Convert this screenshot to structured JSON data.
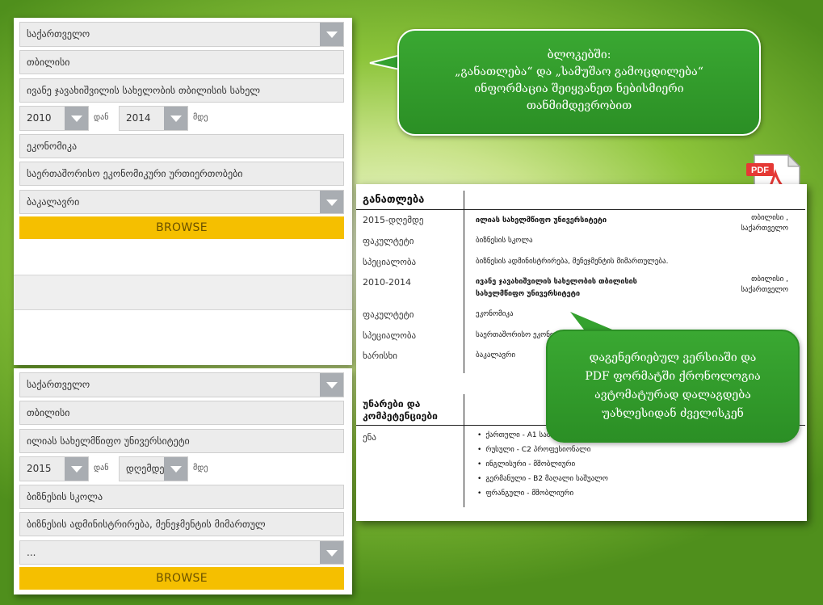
{
  "form_top": {
    "country": "საქართველო",
    "city": "თბილისი",
    "university": "ივანე ჯავახიშვილის სახელობის თბილისის სახელ",
    "year_from": "2010",
    "from_suffix": "დან",
    "year_to": "2014",
    "to_suffix": "მდე",
    "faculty": "ეკონომიკა",
    "specialty": "საერთაშორისო ეკონომიკური ურთიერთობები",
    "degree": "ბაკალავრი",
    "browse_label": "BROWSE"
  },
  "form_bottom": {
    "country": "საქართველო",
    "city": "თბილისი",
    "university": "ილიას სახელმწიფო უნივერსიტეტი",
    "year_from": "2015",
    "from_suffix": "დან",
    "year_to": "დღემდე",
    "to_suffix": "მდე",
    "faculty": "ბიზნესის სკოლა",
    "specialty": "ბიზნესის ადმინისტრირება, მენეჯმენტის მიმართულ",
    "degree": "...",
    "browse_label": "BROWSE"
  },
  "callout_top": {
    "line1": "ბლოკებში:",
    "line2": "„განათლება“ და „სამუშაო გამოცდილება“",
    "line3": "ინფორმაცია შეიყვანეთ ნებისმიერი",
    "line4": "თანმიმდევრობით"
  },
  "callout_bottom": {
    "line1": "დაგენერიებულ ვერსიაში და",
    "line2": "PDF ფორმატში ქრონოლოგია",
    "line3": "ავტომატურად დალაგდება",
    "line4": "უახლესიდან ძველისკენ"
  },
  "pdf_icon": {
    "label": "PDF",
    "accent": "#e53935"
  },
  "cv": {
    "education_heading": "განათლება",
    "entries": [
      {
        "period": "2015-დღემდე",
        "institution_line1": "ილიას სახელმწიფო უნივერსიტეტი",
        "institution_line2": "",
        "city": "თბილისი ,",
        "country": "საქართველო",
        "faculty_label": "ფაკულტეტი",
        "faculty": "ბიზნესის სკოლა",
        "specialty_label": "სპეციალობა",
        "specialty": "ბიზნესის ადმინისტრირება, მენეჯმენტის მიმართულება."
      },
      {
        "period": "2010-2014",
        "institution_line1": "ივანე ჯავახიშვილის სახელობის თბილისის",
        "institution_line2": "სახელმწიფო უნივერსიტეტი",
        "city": "თბილისი ,",
        "country": "საქართველო",
        "faculty_label": "ფაკულტეტი",
        "faculty": "ეკონომიკა",
        "specialty_label": "სპეციალობა",
        "specialty": "საერთაშორისო ეკონომიკური ურთიერთობები",
        "degree_label": "ხარისხი",
        "degree": "ბაკალავრი"
      }
    ],
    "skills_heading_line1": "უნარები და",
    "skills_heading_line2": "კომპეტენციები",
    "language_label": "ენა",
    "languages": [
      "ქართული - A1 საბაზო",
      "რუსული - C2 პროფესიონალი",
      "ინგლისური - მშობლიური",
      "გერმანული - B2 მაღალი საშუალო",
      "ფრანგული - მშობლიური"
    ]
  }
}
